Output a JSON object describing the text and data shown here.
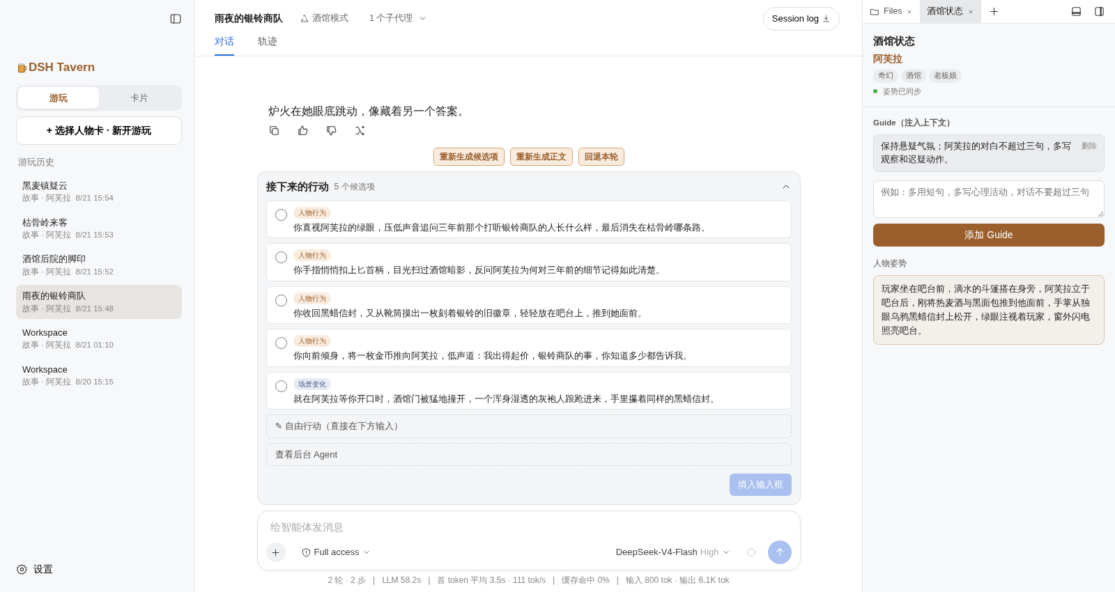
{
  "sidebar": {
    "brand": "DSH Tavern",
    "modes": [
      {
        "label": "游玩",
        "selected": true
      },
      {
        "label": "卡片",
        "selected": false
      }
    ],
    "new_button": "+ 选择人物卡 · 新开游玩",
    "history_title": "游玩历史",
    "history": [
      {
        "title": "黑麦镇疑云",
        "meta": "故事 · 阿芙拉  8/21 15:54",
        "selected": false
      },
      {
        "title": "枯骨岭来客",
        "meta": "故事 · 阿芙拉  8/21 15:53",
        "selected": false
      },
      {
        "title": "酒馆后院的脚印",
        "meta": "故事 · 阿芙拉  8/21 15:52",
        "selected": false
      },
      {
        "title": "雨夜的银铃商队",
        "meta": "故事 · 阿芙拉  8/21 15:48",
        "selected": true
      },
      {
        "title": "Workspace",
        "meta": "故事 · 阿芙拉  8/21 01:10",
        "selected": false
      },
      {
        "title": "Workspace",
        "meta": "故事 · 阿芙拉  8/20 15:15",
        "selected": false
      }
    ],
    "settings": "设置"
  },
  "header": {
    "title": "雨夜的银铃商队",
    "mode": "酒馆模式",
    "subagents": "1 个子代理",
    "session_log": "Session log",
    "tabs": [
      {
        "label": "对话",
        "selected": true
      },
      {
        "label": "轨迹",
        "selected": false
      }
    ]
  },
  "message": {
    "text": "炉火在她眼底跳动，像藏着另一个答案。"
  },
  "action_buttons": [
    "重新生成候选项",
    "重新生成正文",
    "回退本轮"
  ],
  "choices_panel": {
    "title": "接下来的行动",
    "count": "5 个候选项",
    "expanded": true,
    "choices": [
      {
        "tag": "人物行为",
        "kind": "character",
        "text": "你直视阿芙拉的绿眼，压低声音追问三年前那个打听银铃商队的人长什么样，最后消失在枯骨岭哪条路。",
        "selected": false
      },
      {
        "tag": "人物行为",
        "kind": "character",
        "text": "你手指悄悄扣上匕首柄，目光扫过酒馆暗影，反问阿芙拉为何对三年前的细节记得如此清楚。",
        "selected": false
      },
      {
        "tag": "人物行为",
        "kind": "character",
        "text": "你收回黑蜡信封，又从靴筒摸出一枚刻着银铃的旧徽章，轻轻放在吧台上，推到她面前。",
        "selected": false
      },
      {
        "tag": "人物行为",
        "kind": "character",
        "text": "你向前倾身，将一枚金币推向阿芙拉，低声道：我出得起价，银铃商队的事，你知道多少都告诉我。",
        "selected": false
      },
      {
        "tag": "场景变化",
        "kind": "scene",
        "text": "就在阿芙拉等你开口时，酒馆门被猛地撞开，一个浑身湿透的灰袍人踉跄进来，手里攥着同样的黑蜡信封。",
        "selected": false
      }
    ],
    "free_action": "✎ 自由行动（直接在下方输入）",
    "agent_link": "查看后台 Agent",
    "fill_button": "填入输入框",
    "fill_disabled": true
  },
  "composer": {
    "placeholder": "给智能体发消息",
    "access": "Full access",
    "model": "DeepSeek-V4-Flash",
    "effort": "High"
  },
  "status_bar": "2 轮 · 2 步   |   LLM 58.2s   |   首 token 平均 3.5s · 111 tok/s   |   缓存命中 0%   |   输入 800 tok · 输出 6.1K tok",
  "right_panel": {
    "tabs": [
      {
        "label": "Files",
        "selected": false
      },
      {
        "label": "酒馆状态",
        "selected": true
      }
    ],
    "title": "酒馆状态",
    "character": "阿芙拉",
    "tags": [
      "奇幻",
      "酒馆",
      "老板娘"
    ],
    "sync": {
      "text": "姿势已同步",
      "color": "#4caf50"
    },
    "guide_label": "Guide（注入上下文）",
    "guide_text": "保持悬疑气氛；阿芙拉的对白不超过三句，多写观察和迟疑动作。",
    "guide_delete": "删除",
    "guide_placeholder": "例如：多用短句，多写心理活动，对话不要超过三句",
    "add_guide": "添加 Guide",
    "pose_label": "人物姿势",
    "pose_text": "玩家坐在吧台前，滴水的斗篷搭在身旁，阿芙拉立于吧台后，刚将热麦酒与黑面包推到他面前，手掌从独眼乌鸦黑蜡信封上松开，绿眼注视着玩家，窗外闪电照亮吧台。"
  }
}
